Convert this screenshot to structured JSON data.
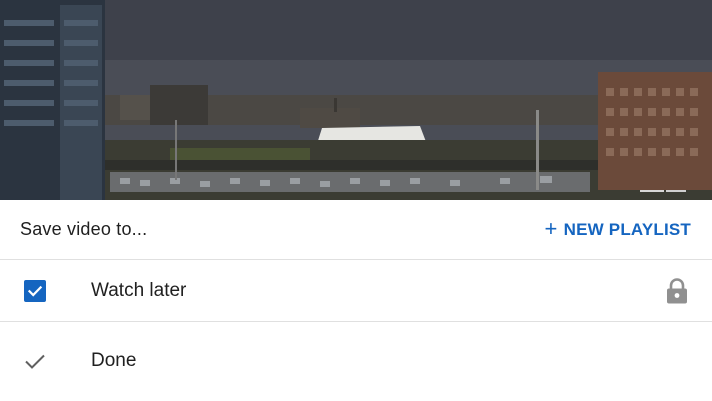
{
  "video": {
    "scene": "city-skyline-video-thumbnail"
  },
  "sheet": {
    "title": "Save video to...",
    "new_playlist_label": "NEW PLAYLIST",
    "playlists": [
      {
        "label": "Watch later",
        "checked": true,
        "privacy_icon": "lock-icon"
      }
    ],
    "done_label": "Done"
  },
  "colors": {
    "accent": "#1565c0",
    "text": "#202020",
    "icon_gray": "#909090",
    "divider": "#e0e0e0"
  }
}
